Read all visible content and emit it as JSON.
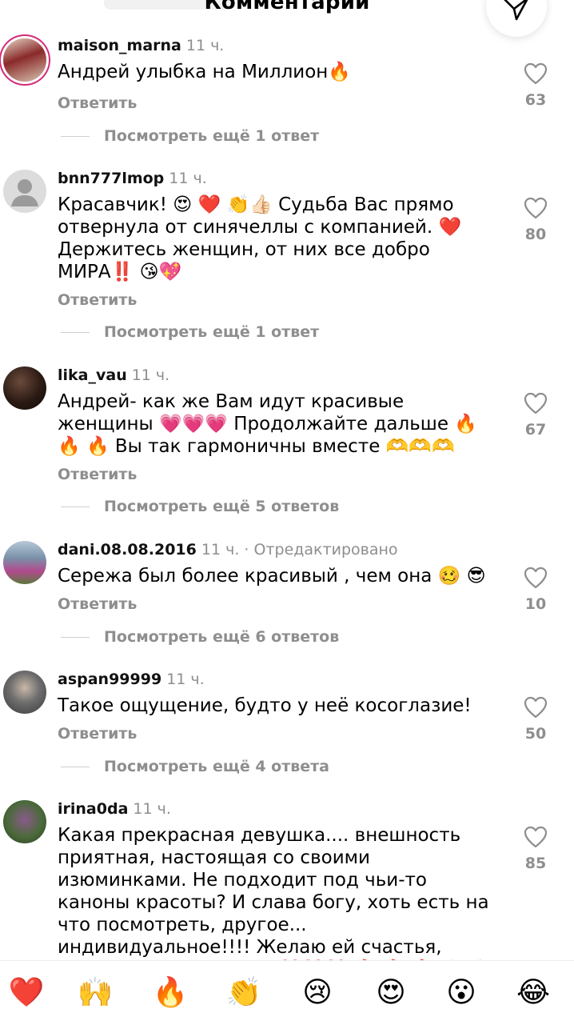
{
  "header": {
    "title": "Комментарии"
  },
  "ui": {
    "reply_label": "Ответить"
  },
  "comments": [
    {
      "username": "maison_marna",
      "time": "11 ч.",
      "text": "Андрей улыбка на Миллион🔥",
      "likes": "63",
      "more_replies": "Посмотреть ещё 1 ответ"
    },
    {
      "username": "bnn777lmop",
      "time": "11 ч.",
      "text": "Красавчик! 😍 ❤️ 👏👍🏻 Судьба Вас прямо отвернула от синячеллы с компанией. ❤️ Держитесь женщин, от них все добро МИРА‼️ 😘💖",
      "likes": "80",
      "more_replies": "Посмотреть ещё 1 ответ"
    },
    {
      "username": "lika_vau",
      "time": "11 ч.",
      "text": "Андрей- как же Вам идут красивые женщины 💗💗💗 Продолжайте дальше 🔥 🔥 🔥 Вы так гармоничны вместе 🫶🫶🫶",
      "likes": "67",
      "more_replies": "Посмотреть ещё 5 ответов"
    },
    {
      "username": "dani.08.08.2016",
      "time": "11 ч.",
      "edited": " · Отредактировано",
      "text": "Сережа был более красивый , чем она 🥴 😎",
      "likes": "10",
      "more_replies": "Посмотреть ещё 6 ответов"
    },
    {
      "username": "aspan99999",
      "time": "11 ч.",
      "text": "Такое ощущение, будто у неё косоглазие!",
      "likes": "50",
      "more_replies": "Посмотреть ещё 4 ответа"
    },
    {
      "username": "irina0da",
      "time": "11 ч.",
      "text": "Какая прекрасная девушка.... внешность приятная, настоящая со своими изюминками. Не подходит под чьи-то каноны красоты? И слава богу, хоть есть на что посмотреть, другое... индивидуальное!!!! Желаю ей счастья, любви, удачи в жизни ❤️❤️❤️ 🔥 🔥 🔥 🙌👏👏👏",
      "likes": "85"
    }
  ],
  "reactions": [
    "❤️",
    "🙌",
    "🔥",
    "👏",
    "😢",
    "😍",
    "😮",
    "😂"
  ],
  "colors": {
    "secondary_text": "#8e8e8e",
    "story_ring": "#d62976"
  },
  "icons": [
    "send-icon",
    "heart-outline-icon",
    "default-avatar-icon"
  ]
}
